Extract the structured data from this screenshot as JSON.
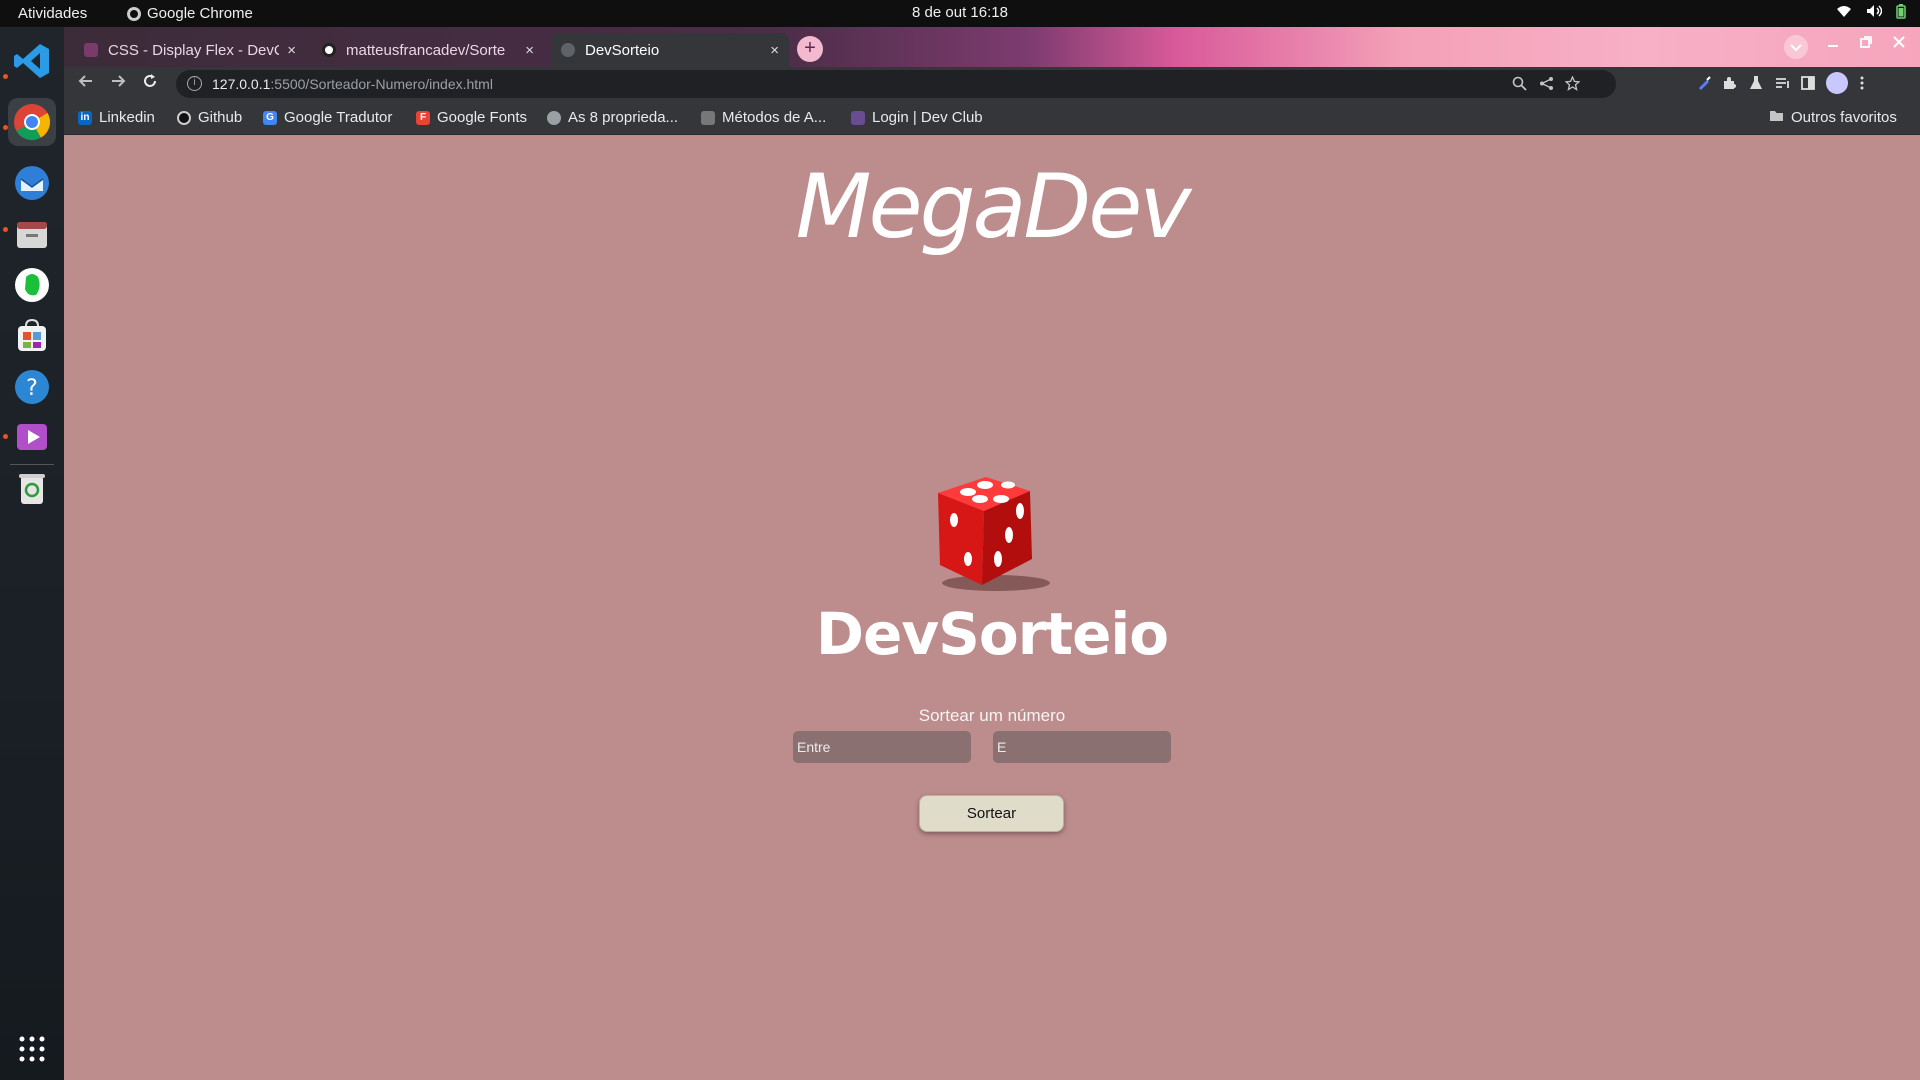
{
  "system": {
    "activities": "Atividades",
    "app_name": "Google Chrome",
    "clock": "8 de out  16:18"
  },
  "tabs": [
    {
      "title": "CSS - Display Flex - DevCl",
      "active": false
    },
    {
      "title": "matteusfrancadev/Sorte",
      "active": false
    },
    {
      "title": "DevSorteio",
      "active": true
    }
  ],
  "tab_close_glyph": "×",
  "new_tab_glyph": "+",
  "toolbar": {
    "url_host": "127.0.0.1",
    "url_path": ":5500/Sorteador-Numero/index.html"
  },
  "bookmarks": [
    {
      "label": "Linkedin",
      "icon": "linkedin-icon",
      "color": "#0a66c2"
    },
    {
      "label": "Github",
      "icon": "github-icon",
      "color": "#222222"
    },
    {
      "label": "Google Tradutor",
      "icon": "translate-icon",
      "color": "#4285f4"
    },
    {
      "label": "Google Fonts",
      "icon": "fonts-icon",
      "color": "#ea4335"
    },
    {
      "label": "As 8 proprieda...",
      "icon": "globe-icon",
      "color": "#9aa0a6"
    },
    {
      "label": "Métodos de A...",
      "icon": "doc-icon",
      "color": "#777777"
    },
    {
      "label": "Login | Dev Club",
      "icon": "devclub-icon",
      "color": "#6a4c93"
    }
  ],
  "other_bookmarks": "Outros favoritos",
  "page": {
    "brand": "MegaDev",
    "title": "DevSorteio",
    "subtitle": "Sortear um número",
    "input_from_placeholder": "Entre",
    "input_to_placeholder": "E",
    "button_label": "Sortear",
    "background": "#bd8c8c"
  }
}
